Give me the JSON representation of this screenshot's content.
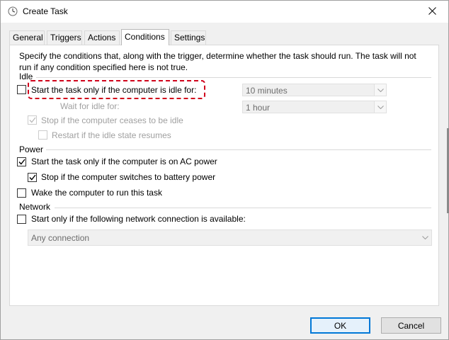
{
  "window": {
    "title": "Create Task"
  },
  "tabs": [
    "General",
    "Triggers",
    "Actions",
    "Conditions",
    "Settings"
  ],
  "active_tab": "Conditions",
  "intro_text": "Specify the conditions that, along with the trigger, determine whether the task should run.  The task will not run  if any condition specified here is not true.",
  "idle": {
    "label": "Idle",
    "start_if_idle": {
      "label": "Start the task only if the computer is idle for:",
      "checked": false
    },
    "idle_duration": "10 minutes",
    "wait_label": "Wait for idle for:",
    "wait_duration": "1 hour",
    "stop_if_ceases": {
      "label": "Stop if the computer ceases to be idle",
      "checked": true
    },
    "restart_if_resumes": {
      "label": "Restart if the idle state resumes",
      "checked": false
    }
  },
  "power": {
    "label": "Power",
    "ac_power": {
      "label": "Start the task only if the computer is on AC power",
      "checked": true
    },
    "battery_stop": {
      "label": "Stop if the computer switches to battery power",
      "checked": true
    },
    "wake": {
      "label": "Wake the computer to run this task",
      "checked": false
    }
  },
  "network": {
    "label": "Network",
    "start_if_network": {
      "label": "Start only if the following network connection is available:",
      "checked": false
    },
    "connection": "Any connection"
  },
  "buttons": {
    "ok": "OK",
    "cancel": "Cancel"
  },
  "colors": {
    "highlight": "#d0021b",
    "accent": "#0078d7"
  }
}
